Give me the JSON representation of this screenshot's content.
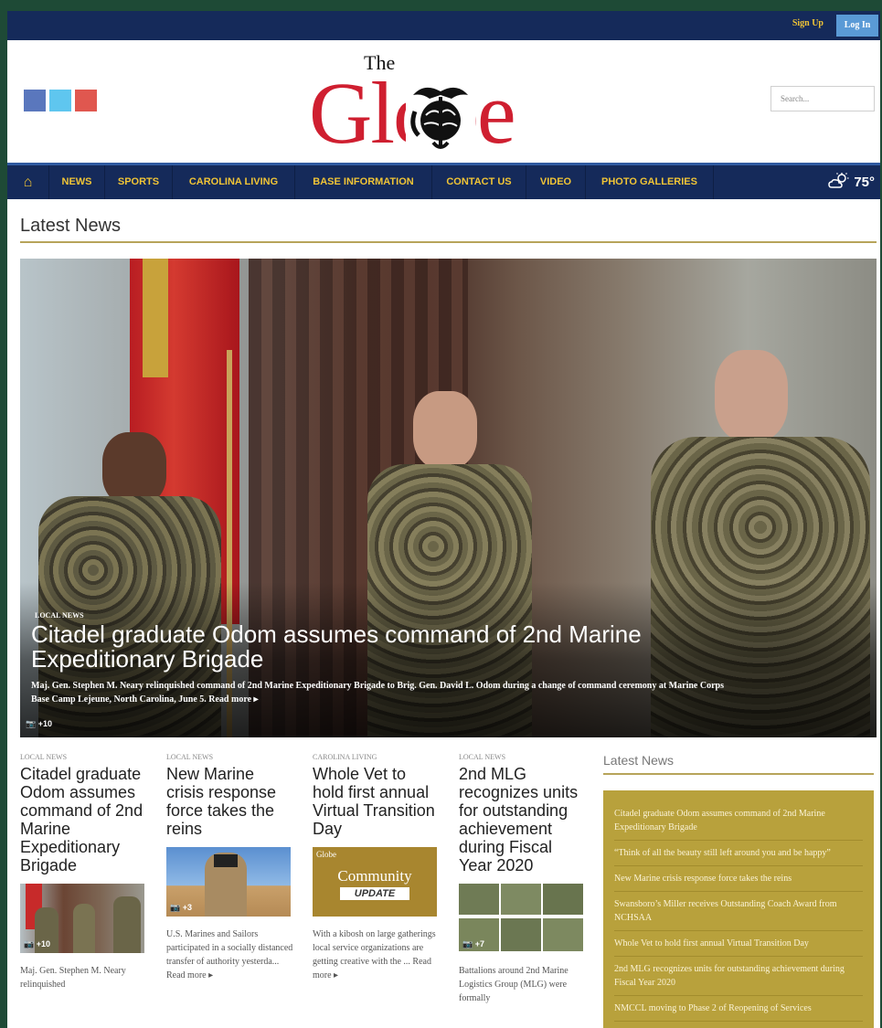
{
  "topbar": {
    "signup_label": "Sign Up",
    "login_label": "Log In"
  },
  "header": {
    "logo_small": "The",
    "logo_word": "Globe",
    "search_placeholder": "Search..."
  },
  "nav": {
    "items": [
      "NEWS",
      "SPORTS",
      "CAROLINA LIVING",
      "BASE INFORMATION",
      "CONTACT US",
      "VIDEO",
      "PHOTO GALLERIES"
    ],
    "weather_temp": "75°",
    "weather_icon": "partly-cloudy-icon"
  },
  "section_title": "Latest News",
  "hero": {
    "tag": "LOCAL NEWS",
    "title": "Citadel graduate Odom assumes command of 2nd Marine Expeditionary Brigade",
    "description": "Maj. Gen. Stephen M. Neary relinquished command of 2nd Marine Expeditionary Brigade to Brig. Gen. David L. Odom during a change of command ceremony at Marine Corps Base Camp Lejeune, North Carolina, June 5. Read more ▸",
    "photo_count": "+10"
  },
  "articles": [
    {
      "tag": "LOCAL NEWS",
      "title": "Citadel graduate Odom assumes command of 2nd Marine Expeditionary Brigade",
      "photo_count": "+10",
      "excerpt": "Maj. Gen. Stephen M. Neary relinquished"
    },
    {
      "tag": "LOCAL NEWS",
      "title": "New Marine crisis response force takes the reins",
      "photo_count": "+3",
      "excerpt": "U.S. Marines and Sailors participated in a socially distanced transfer of authority yesterda... Read more ▸"
    },
    {
      "tag": "CAROLINA LIVING",
      "title": "Whole Vet to hold first annual Virtual Transition Day",
      "image_line1": "Community",
      "image_line2": "UPDATE",
      "image_logo": "Globe",
      "excerpt": "With a kibosh on large gatherings local service organizations are getting creative with the ... Read more ▸"
    },
    {
      "tag": "LOCAL NEWS",
      "title": "2nd MLG recognizes units for outstanding achievement during Fiscal Year 2020",
      "photo_count": "+7",
      "excerpt": "Battalions around 2nd Marine Logistics Group (MLG) were formally"
    }
  ],
  "sidebar": {
    "title": "Latest News",
    "items": [
      "Citadel graduate Odom assumes command of 2nd Marine Expeditionary Brigade",
      "“Think of all the beauty still left around you and be happy”",
      "New Marine crisis response force takes the reins",
      "Swansboro’s Miller receives Outstanding Coach Award from NCHSAA",
      "Whole Vet to hold first annual Virtual Transition Day",
      "2nd MLG recognizes units for outstanding achievement during Fiscal Year 2020",
      "NMCCL moving to Phase 2 of Reopening of Services"
    ]
  },
  "colors": {
    "nav_bg": "#152a5a",
    "nav_text": "#f0c436",
    "logo_red": "#cf1f30",
    "sidebar_bg": "#b8a13c",
    "accent_rule": "#b7a45a"
  }
}
